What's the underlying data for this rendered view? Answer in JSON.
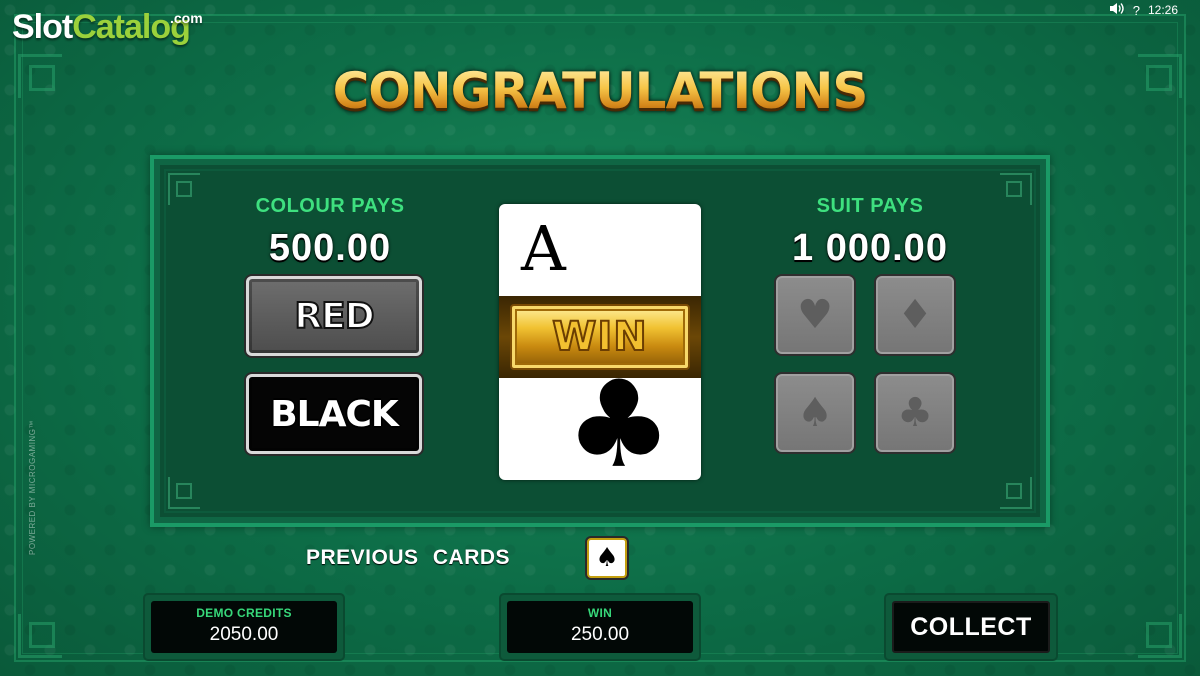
{
  "brand": {
    "slot": "Slot",
    "catalog": "Catalog",
    "com": ".com"
  },
  "status_bar": {
    "sound_icon": "speaker-icon",
    "help_icon": "question-icon",
    "help_label": "?",
    "clock": "12:26"
  },
  "side_text": "POWERED BY MICROGAMING™",
  "title": "CONGRATULATIONS",
  "colour_pays": {
    "label": "COLOUR PAYS",
    "amount": "500.00",
    "red_label": "RED",
    "black_label": "BLACK"
  },
  "card": {
    "rank": "A",
    "suit": "clubs",
    "suit_glyph": "♣",
    "win_label": "WIN"
  },
  "suit_pays": {
    "label": "SUIT PAYS",
    "amount": "1 000.00",
    "suits": [
      {
        "name": "hearts",
        "glyph": "♥"
      },
      {
        "name": "diamonds",
        "glyph": "♦"
      },
      {
        "name": "spades",
        "glyph": "♠"
      },
      {
        "name": "clubs",
        "glyph": "♣"
      }
    ]
  },
  "previous_cards": {
    "label": "PREVIOUS  CARDS",
    "cards": [
      {
        "suit": "spades",
        "glyph": "♠"
      }
    ]
  },
  "demo_credits": {
    "label": "DEMO CREDITS",
    "value": "2050.00"
  },
  "win": {
    "label": "WIN",
    "value": "250.00"
  },
  "collect_label": "COLLECT",
  "colors": {
    "accent_green": "#3ee07f",
    "gold": "#f3c24c",
    "background": "#0d6d47"
  }
}
